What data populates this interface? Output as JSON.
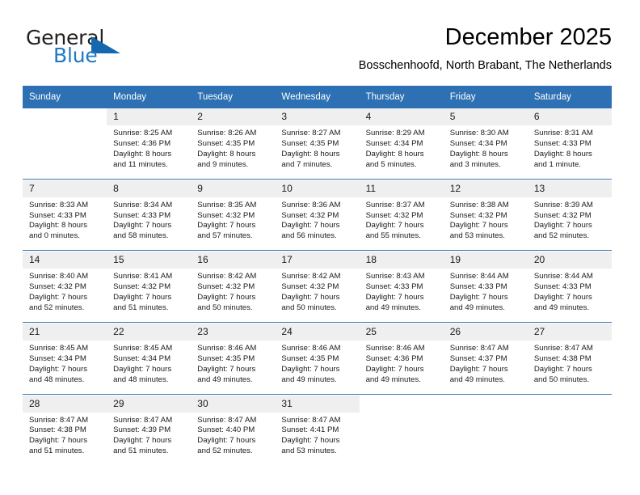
{
  "brand": {
    "name_part1": "General",
    "name_part2": "Blue",
    "logo_icon": "blue-triangle-icon",
    "color_dark": "#231f20",
    "color_blue": "#1f7ac4"
  },
  "header": {
    "title": "December 2025",
    "subtitle": "Bosschenhoofd, North Brabant, The Netherlands"
  },
  "theme": {
    "header_blue": "#2d70b3",
    "daynum_band": "#efefef",
    "separator": "#3a79b5"
  },
  "weekday_headers": [
    "Sunday",
    "Monday",
    "Tuesday",
    "Wednesday",
    "Thursday",
    "Friday",
    "Saturday"
  ],
  "weeks": [
    {
      "days": [
        {
          "num": "",
          "sunrise": "",
          "sunset": "",
          "daylight1": "",
          "daylight2": ""
        },
        {
          "num": "1",
          "sunrise": "Sunrise: 8:25 AM",
          "sunset": "Sunset: 4:36 PM",
          "daylight1": "Daylight: 8 hours",
          "daylight2": "and 11 minutes."
        },
        {
          "num": "2",
          "sunrise": "Sunrise: 8:26 AM",
          "sunset": "Sunset: 4:35 PM",
          "daylight1": "Daylight: 8 hours",
          "daylight2": "and 9 minutes."
        },
        {
          "num": "3",
          "sunrise": "Sunrise: 8:27 AM",
          "sunset": "Sunset: 4:35 PM",
          "daylight1": "Daylight: 8 hours",
          "daylight2": "and 7 minutes."
        },
        {
          "num": "4",
          "sunrise": "Sunrise: 8:29 AM",
          "sunset": "Sunset: 4:34 PM",
          "daylight1": "Daylight: 8 hours",
          "daylight2": "and 5 minutes."
        },
        {
          "num": "5",
          "sunrise": "Sunrise: 8:30 AM",
          "sunset": "Sunset: 4:34 PM",
          "daylight1": "Daylight: 8 hours",
          "daylight2": "and 3 minutes."
        },
        {
          "num": "6",
          "sunrise": "Sunrise: 8:31 AM",
          "sunset": "Sunset: 4:33 PM",
          "daylight1": "Daylight: 8 hours",
          "daylight2": "and 1 minute."
        }
      ]
    },
    {
      "days": [
        {
          "num": "7",
          "sunrise": "Sunrise: 8:33 AM",
          "sunset": "Sunset: 4:33 PM",
          "daylight1": "Daylight: 8 hours",
          "daylight2": "and 0 minutes."
        },
        {
          "num": "8",
          "sunrise": "Sunrise: 8:34 AM",
          "sunset": "Sunset: 4:33 PM",
          "daylight1": "Daylight: 7 hours",
          "daylight2": "and 58 minutes."
        },
        {
          "num": "9",
          "sunrise": "Sunrise: 8:35 AM",
          "sunset": "Sunset: 4:32 PM",
          "daylight1": "Daylight: 7 hours",
          "daylight2": "and 57 minutes."
        },
        {
          "num": "10",
          "sunrise": "Sunrise: 8:36 AM",
          "sunset": "Sunset: 4:32 PM",
          "daylight1": "Daylight: 7 hours",
          "daylight2": "and 56 minutes."
        },
        {
          "num": "11",
          "sunrise": "Sunrise: 8:37 AM",
          "sunset": "Sunset: 4:32 PM",
          "daylight1": "Daylight: 7 hours",
          "daylight2": "and 55 minutes."
        },
        {
          "num": "12",
          "sunrise": "Sunrise: 8:38 AM",
          "sunset": "Sunset: 4:32 PM",
          "daylight1": "Daylight: 7 hours",
          "daylight2": "and 53 minutes."
        },
        {
          "num": "13",
          "sunrise": "Sunrise: 8:39 AM",
          "sunset": "Sunset: 4:32 PM",
          "daylight1": "Daylight: 7 hours",
          "daylight2": "and 52 minutes."
        }
      ]
    },
    {
      "days": [
        {
          "num": "14",
          "sunrise": "Sunrise: 8:40 AM",
          "sunset": "Sunset: 4:32 PM",
          "daylight1": "Daylight: 7 hours",
          "daylight2": "and 52 minutes."
        },
        {
          "num": "15",
          "sunrise": "Sunrise: 8:41 AM",
          "sunset": "Sunset: 4:32 PM",
          "daylight1": "Daylight: 7 hours",
          "daylight2": "and 51 minutes."
        },
        {
          "num": "16",
          "sunrise": "Sunrise: 8:42 AM",
          "sunset": "Sunset: 4:32 PM",
          "daylight1": "Daylight: 7 hours",
          "daylight2": "and 50 minutes."
        },
        {
          "num": "17",
          "sunrise": "Sunrise: 8:42 AM",
          "sunset": "Sunset: 4:32 PM",
          "daylight1": "Daylight: 7 hours",
          "daylight2": "and 50 minutes."
        },
        {
          "num": "18",
          "sunrise": "Sunrise: 8:43 AM",
          "sunset": "Sunset: 4:33 PM",
          "daylight1": "Daylight: 7 hours",
          "daylight2": "and 49 minutes."
        },
        {
          "num": "19",
          "sunrise": "Sunrise: 8:44 AM",
          "sunset": "Sunset: 4:33 PM",
          "daylight1": "Daylight: 7 hours",
          "daylight2": "and 49 minutes."
        },
        {
          "num": "20",
          "sunrise": "Sunrise: 8:44 AM",
          "sunset": "Sunset: 4:33 PM",
          "daylight1": "Daylight: 7 hours",
          "daylight2": "and 49 minutes."
        }
      ]
    },
    {
      "days": [
        {
          "num": "21",
          "sunrise": "Sunrise: 8:45 AM",
          "sunset": "Sunset: 4:34 PM",
          "daylight1": "Daylight: 7 hours",
          "daylight2": "and 48 minutes."
        },
        {
          "num": "22",
          "sunrise": "Sunrise: 8:45 AM",
          "sunset": "Sunset: 4:34 PM",
          "daylight1": "Daylight: 7 hours",
          "daylight2": "and 48 minutes."
        },
        {
          "num": "23",
          "sunrise": "Sunrise: 8:46 AM",
          "sunset": "Sunset: 4:35 PM",
          "daylight1": "Daylight: 7 hours",
          "daylight2": "and 49 minutes."
        },
        {
          "num": "24",
          "sunrise": "Sunrise: 8:46 AM",
          "sunset": "Sunset: 4:35 PM",
          "daylight1": "Daylight: 7 hours",
          "daylight2": "and 49 minutes."
        },
        {
          "num": "25",
          "sunrise": "Sunrise: 8:46 AM",
          "sunset": "Sunset: 4:36 PM",
          "daylight1": "Daylight: 7 hours",
          "daylight2": "and 49 minutes."
        },
        {
          "num": "26",
          "sunrise": "Sunrise: 8:47 AM",
          "sunset": "Sunset: 4:37 PM",
          "daylight1": "Daylight: 7 hours",
          "daylight2": "and 49 minutes."
        },
        {
          "num": "27",
          "sunrise": "Sunrise: 8:47 AM",
          "sunset": "Sunset: 4:38 PM",
          "daylight1": "Daylight: 7 hours",
          "daylight2": "and 50 minutes."
        }
      ]
    },
    {
      "days": [
        {
          "num": "28",
          "sunrise": "Sunrise: 8:47 AM",
          "sunset": "Sunset: 4:38 PM",
          "daylight1": "Daylight: 7 hours",
          "daylight2": "and 51 minutes."
        },
        {
          "num": "29",
          "sunrise": "Sunrise: 8:47 AM",
          "sunset": "Sunset: 4:39 PM",
          "daylight1": "Daylight: 7 hours",
          "daylight2": "and 51 minutes."
        },
        {
          "num": "30",
          "sunrise": "Sunrise: 8:47 AM",
          "sunset": "Sunset: 4:40 PM",
          "daylight1": "Daylight: 7 hours",
          "daylight2": "and 52 minutes."
        },
        {
          "num": "31",
          "sunrise": "Sunrise: 8:47 AM",
          "sunset": "Sunset: 4:41 PM",
          "daylight1": "Daylight: 7 hours",
          "daylight2": "and 53 minutes."
        },
        {
          "num": "",
          "sunrise": "",
          "sunset": "",
          "daylight1": "",
          "daylight2": ""
        },
        {
          "num": "",
          "sunrise": "",
          "sunset": "",
          "daylight1": "",
          "daylight2": ""
        },
        {
          "num": "",
          "sunrise": "",
          "sunset": "",
          "daylight1": "",
          "daylight2": ""
        }
      ]
    }
  ]
}
